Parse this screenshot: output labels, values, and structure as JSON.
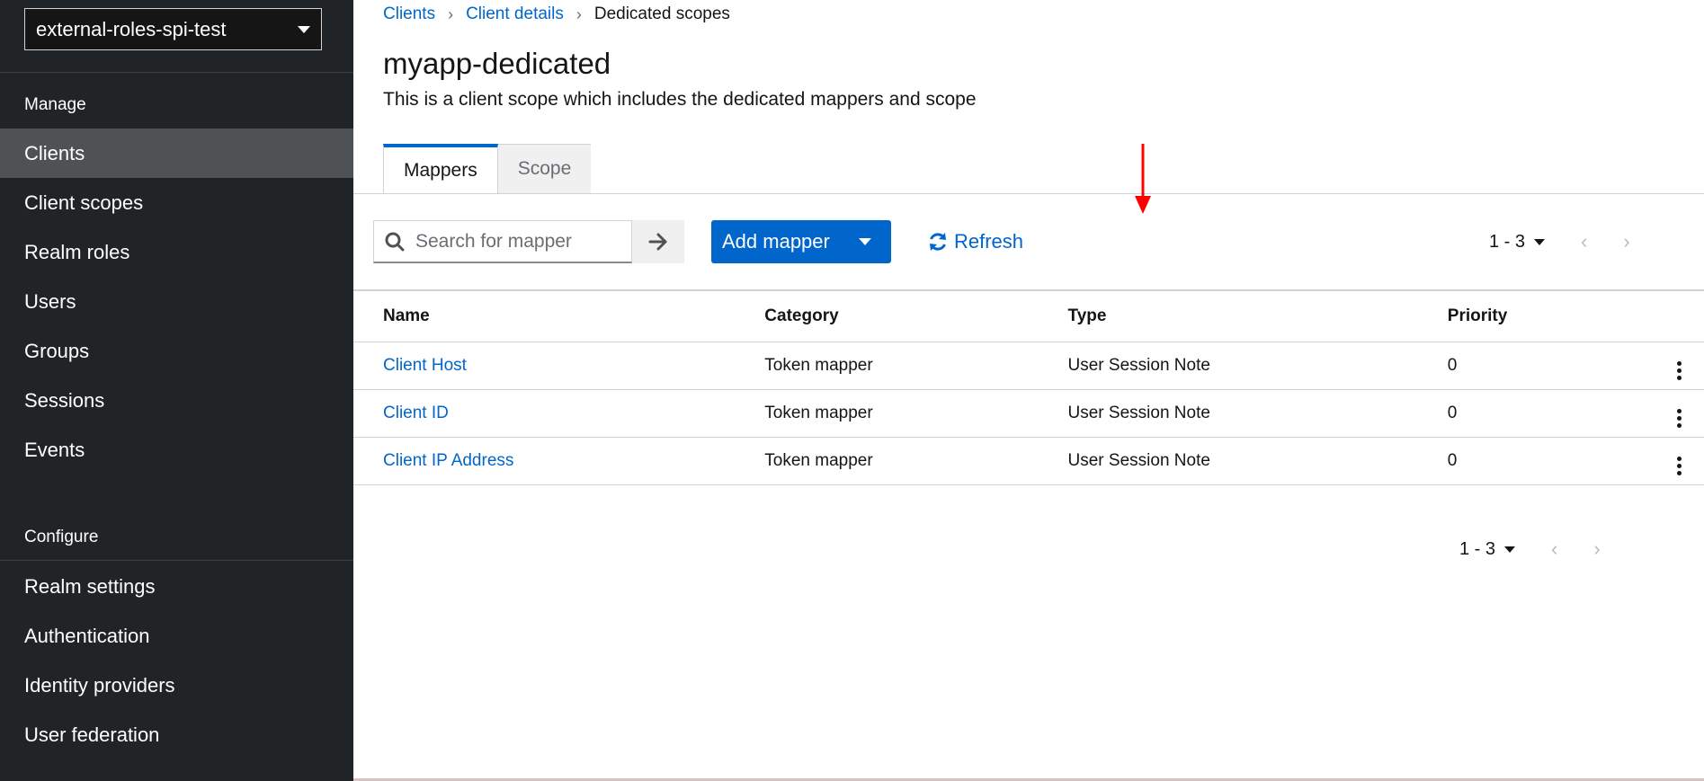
{
  "sidebar": {
    "realm": "external-roles-spi-test",
    "manage_title": "Manage",
    "manage_items": [
      "Clients",
      "Client scopes",
      "Realm roles",
      "Users",
      "Groups",
      "Sessions",
      "Events"
    ],
    "configure_title": "Configure",
    "configure_items": [
      "Realm settings",
      "Authentication",
      "Identity providers",
      "User federation"
    ],
    "active_item": "Clients"
  },
  "breadcrumb": {
    "items": [
      "Clients",
      "Client details"
    ],
    "current": "Dedicated scopes"
  },
  "page": {
    "title": "myapp-dedicated",
    "subtitle": "This is a client scope which includes the dedicated mappers and scope"
  },
  "tabs": [
    {
      "label": "Mappers",
      "active": true
    },
    {
      "label": "Scope",
      "active": false
    }
  ],
  "toolbar": {
    "search_placeholder": "Search for mapper",
    "add_mapper_label": "Add mapper",
    "refresh_label": "Refresh",
    "pagination_top": "1 - 3",
    "pagination_bottom": "1 - 3"
  },
  "table": {
    "headers": [
      "Name",
      "Category",
      "Type",
      "Priority"
    ],
    "rows": [
      {
        "name": "Client Host",
        "category": "Token mapper",
        "type": "User Session Note",
        "priority": "0"
      },
      {
        "name": "Client ID",
        "category": "Token mapper",
        "type": "User Session Note",
        "priority": "0"
      },
      {
        "name": "Client IP Address",
        "category": "Token mapper",
        "type": "User Session Note",
        "priority": "0"
      }
    ]
  },
  "colors": {
    "sidebar_bg": "#212427",
    "sidebar_active": "#4f5255",
    "primary": "#0066cc",
    "annotation_arrow": "#ff0000"
  },
  "icons": [
    "search-icon",
    "arrow-right-icon",
    "chevron-down-icon",
    "refresh-icon",
    "chevron-left-icon",
    "chevron-right-icon",
    "kebab-icon"
  ]
}
